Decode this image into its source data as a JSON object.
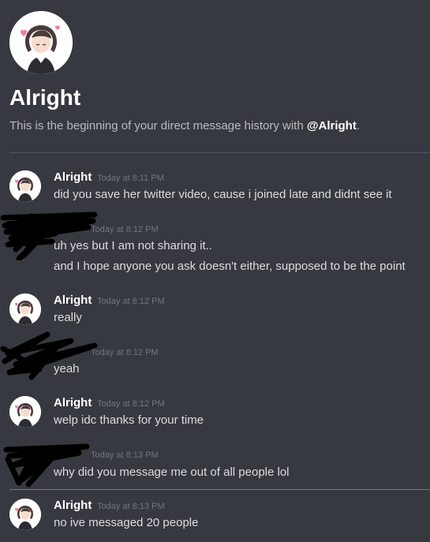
{
  "header": {
    "title": "Alright",
    "intro_prefix": "This is the beginning of your direct message history with ",
    "intro_mention": "@Alright",
    "intro_suffix": "."
  },
  "messages": [
    {
      "author": "Alright",
      "time": "Today at 8:11 PM",
      "lines": [
        "did you save her twitter video, cause i joined late and didnt see it"
      ]
    },
    {
      "author": "",
      "time": "Today at 8:12 PM",
      "lines": [
        "uh yes but I am not sharing it..",
        "and I hope anyone you ask doesn't either, supposed to be the point"
      ]
    },
    {
      "author": "Alright",
      "time": "Today at 8:12 PM",
      "lines": [
        "really"
      ]
    },
    {
      "author": "",
      "time": "Today at 8:12 PM",
      "lines": [
        "yeah"
      ]
    },
    {
      "author": "Alright",
      "time": "Today at 8:12 PM",
      "lines": [
        "welp idc thanks for your time"
      ]
    },
    {
      "author": "",
      "time": "Today at 8:13 PM",
      "lines": [
        "why did you message me out of all people lol"
      ]
    },
    {
      "author": "Alright",
      "time": "Today at 8:13 PM",
      "lines": [
        "no ive messaged 20 people"
      ]
    }
  ],
  "colors": {
    "background": "#36393f",
    "text": "#dcddde",
    "muted": "#72767d",
    "new_marker": "#f04747"
  }
}
